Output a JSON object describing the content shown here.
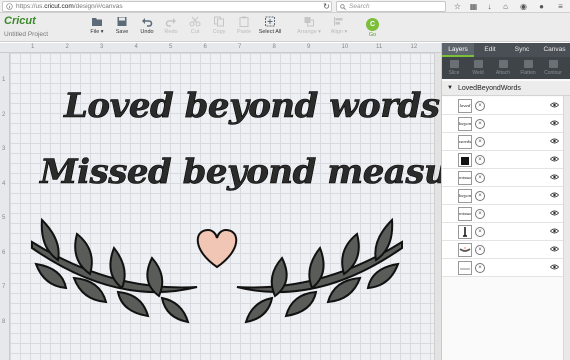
{
  "browser": {
    "url_host": "https://us.",
    "url_domain": "cricut.com",
    "url_path": "/design/#/canvas",
    "search_placeholder": "Search"
  },
  "app": {
    "logo": "Cricut",
    "project_name": "Untitled Project",
    "toolbar": {
      "file": "File ▾",
      "save": "Save",
      "undo": "Undo",
      "redo": "Redo",
      "cut": "Cut",
      "copy": "Copy",
      "paste": "Paste",
      "select_all": "Select All",
      "arrange": "Arrange ▾",
      "align": "Align ▾",
      "go_icon": "C",
      "go": "Go"
    }
  },
  "canvas": {
    "ruler_top": [
      "1",
      "2",
      "3",
      "4",
      "5",
      "6",
      "7",
      "8",
      "9",
      "10",
      "11",
      "12"
    ],
    "ruler_left": [
      "1",
      "2",
      "3",
      "4",
      "5",
      "6",
      "7",
      "8"
    ],
    "line1": "Loved beyond words",
    "line2": "Missed beyond measure",
    "colors": {
      "text": "#2b2b2b",
      "leaves": "#5a5c5a",
      "heart": "#f2c6b4"
    }
  },
  "panel": {
    "tabs": [
      "Layers",
      "Edit",
      "Sync",
      "Canvas"
    ],
    "actions": [
      "Slice",
      "Weld",
      "Attach",
      "Flatten",
      "Contour"
    ],
    "group_name": "LovedBeyondWords",
    "layers": [
      {
        "thumb": "loved"
      },
      {
        "thumb": "beyond"
      },
      {
        "thumb": "words"
      },
      {
        "thumb": ""
      },
      {
        "thumb": "missed"
      },
      {
        "thumb": "beyond"
      },
      {
        "thumb": "missed"
      },
      {
        "thumb": ""
      },
      {
        "thumb": ""
      },
      {
        "thumb": ""
      }
    ]
  }
}
